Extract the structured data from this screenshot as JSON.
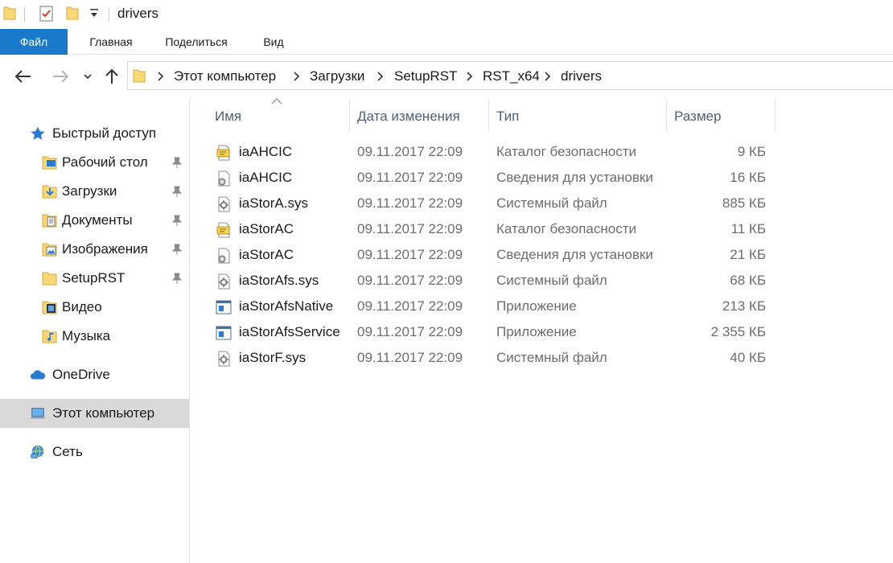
{
  "window": {
    "title": "drivers"
  },
  "ribbon": {
    "tabs": [
      "Файл",
      "Главная",
      "Поделиться",
      "Вид"
    ]
  },
  "address": {
    "crumbs": [
      "Этот компьютер",
      "Загрузки",
      "SetupRST",
      "RST_x64",
      "drivers"
    ]
  },
  "sidebar": {
    "quick_access": "Быстрый доступ",
    "items": [
      {
        "label": "Рабочий стол",
        "icon": "desktop-folder-icon",
        "pinned": true
      },
      {
        "label": "Загрузки",
        "icon": "downloads-folder-icon",
        "pinned": true
      },
      {
        "label": "Документы",
        "icon": "documents-folder-icon",
        "pinned": true
      },
      {
        "label": "Изображения",
        "icon": "pictures-folder-icon",
        "pinned": true
      },
      {
        "label": "SetupRST",
        "icon": "folder-icon",
        "pinned": true
      },
      {
        "label": "Видео",
        "icon": "videos-folder-icon",
        "pinned": false
      },
      {
        "label": "Музыка",
        "icon": "music-folder-icon",
        "pinned": false
      }
    ],
    "onedrive": "OneDrive",
    "this_pc": "Этот компьютер",
    "network": "Сеть"
  },
  "columns": {
    "name": "Имя",
    "date": "Дата изменения",
    "type": "Тип",
    "size": "Размер"
  },
  "files": [
    {
      "name": "iaAHCIC",
      "date": "09.11.2017 22:09",
      "type": "Каталог безопасности",
      "size": "9 КБ",
      "icon": "security-catalog-icon"
    },
    {
      "name": "iaAHCIC",
      "date": "09.11.2017 22:09",
      "type": "Сведения для установки",
      "size": "16 КБ",
      "icon": "setup-info-icon"
    },
    {
      "name": "iaStorA.sys",
      "date": "09.11.2017 22:09",
      "type": "Системный файл",
      "size": "885 КБ",
      "icon": "system-file-icon"
    },
    {
      "name": "iaStorAC",
      "date": "09.11.2017 22:09",
      "type": "Каталог безопасности",
      "size": "11 КБ",
      "icon": "security-catalog-icon"
    },
    {
      "name": "iaStorAC",
      "date": "09.11.2017 22:09",
      "type": "Сведения для установки",
      "size": "21 КБ",
      "icon": "setup-info-icon"
    },
    {
      "name": "iaStorAfs.sys",
      "date": "09.11.2017 22:09",
      "type": "Системный файл",
      "size": "68 КБ",
      "icon": "system-file-icon"
    },
    {
      "name": "iaStorAfsNative",
      "date": "09.11.2017 22:09",
      "type": "Приложение",
      "size": "213 КБ",
      "icon": "application-icon"
    },
    {
      "name": "iaStorAfsService",
      "date": "09.11.2017 22:09",
      "type": "Приложение",
      "size": "2 355 КБ",
      "icon": "application-icon"
    },
    {
      "name": "iaStorF.sys",
      "date": "09.11.2017 22:09",
      "type": "Системный файл",
      "size": "40 КБ",
      "icon": "system-file-icon"
    }
  ],
  "colors": {
    "file_tab": "#1979ca",
    "folder": "#f8d775",
    "selected": "#d9d9d9",
    "header_text": "#4c607a"
  }
}
